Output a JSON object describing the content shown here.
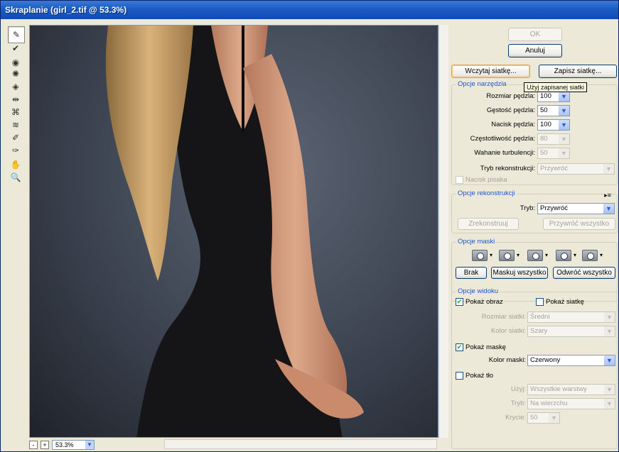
{
  "window": {
    "title": "Skraplanie (girl_2.tif @ 53.3%)"
  },
  "toolbar": {
    "tools": [
      {
        "name": "forward-warp-tool-icon",
        "glyph": "✎"
      },
      {
        "name": "reconstruct-tool-icon",
        "glyph": "✔"
      },
      {
        "name": "twirl-clockwise-tool-icon",
        "glyph": "◉"
      },
      {
        "name": "pucker-tool-icon",
        "glyph": "✺"
      },
      {
        "name": "bloat-tool-icon",
        "glyph": "◈"
      },
      {
        "name": "push-left-tool-icon",
        "glyph": "⇹"
      },
      {
        "name": "mirror-tool-icon",
        "glyph": "⌘"
      },
      {
        "name": "turbulence-tool-icon",
        "glyph": "≋"
      },
      {
        "name": "freeze-mask-tool-icon",
        "glyph": "✐"
      },
      {
        "name": "thaw-mask-tool-icon",
        "glyph": "✑"
      },
      {
        "name": "hand-tool-icon",
        "glyph": "✋"
      },
      {
        "name": "zoom-tool-icon",
        "glyph": "🔍"
      }
    ]
  },
  "zoom": {
    "value": "53.3%",
    "minus": "-",
    "plus": "+"
  },
  "buttons": {
    "ok": "OK",
    "cancel": "Anuluj",
    "load_mesh": "Wczytaj siatkę...",
    "save_mesh": "Zapisz siatkę...",
    "reconstruct": "Zrekonstruuj",
    "restore_all": "Przywróć wszystko",
    "none": "Brak",
    "mask_all": "Maskuj wszystko",
    "invert_all": "Odwróć wszystko"
  },
  "tooltip": "Użyj zapisanej siatki",
  "tool_options": {
    "legend": "Opcje narzędzia",
    "brush_size": {
      "label": "Rozmiar pędzla:",
      "value": "100"
    },
    "brush_density": {
      "label": "Gęstość pędzla:",
      "value": "50"
    },
    "brush_pressure": {
      "label": "Nacisk pędzla:",
      "value": "100"
    },
    "brush_rate": {
      "label": "Częstotliwość pędzla:",
      "value": "80"
    },
    "turbulent_jitter": {
      "label": "Wahanie turbulencji:",
      "value": "50"
    },
    "reconstruct_mode": {
      "label": "Tryb rekonstrukcji:",
      "value": "Przywróć"
    },
    "stylus_pressure": "Nacisk pisaka"
  },
  "reconstruct_options": {
    "legend": "Opcje rekonstrukcji",
    "mode": {
      "label": "Tryb:",
      "value": "Przywróć"
    }
  },
  "mask_options": {
    "legend": "Opcje maski"
  },
  "view_options": {
    "legend": "Opcje widoku",
    "show_image": "Pokaż obraz",
    "show_mesh": "Pokaż siatkę",
    "mesh_size": {
      "label": "Rozmiar siatki:",
      "value": "Średni"
    },
    "mesh_color": {
      "label": "Kolor siatki:",
      "value": "Szary"
    },
    "show_mask": "Pokaż maskę",
    "mask_color": {
      "label": "Kolor maski:",
      "value": "Czerwony"
    },
    "show_backdrop": "Pokaż tło",
    "use": {
      "label": "Użyj:",
      "value": "Wszystkie warstwy"
    },
    "mode": {
      "label": "Tryb:",
      "value": "Na wierzchu"
    },
    "opacity": {
      "label": "Krycie:",
      "value": "50"
    }
  },
  "colors": {
    "title_bar": "#1d5bc4",
    "accent": "#1c55d1",
    "dialog_bg": "#ece9d8"
  }
}
